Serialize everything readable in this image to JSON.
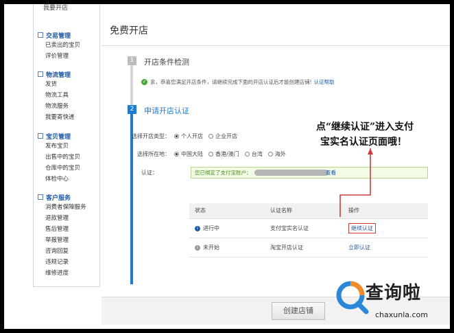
{
  "sidebar": {
    "top_item": "我要开店",
    "sections": [
      {
        "title": "交易管理",
        "items": [
          "已卖出的宝贝",
          "评价管理"
        ]
      },
      {
        "title": "物流管理",
        "items": [
          "发货",
          "物流工具",
          "物流服务",
          "我要寄快递"
        ]
      },
      {
        "title": "宝贝管理",
        "items": [
          "发布宝贝",
          "出售中的宝贝",
          "仓库中的宝贝",
          "体检中心"
        ]
      },
      {
        "title": "客户服务",
        "items": [
          "消费者保障服务",
          "退款管理",
          "售后管理",
          "举报管理",
          "咨询回复",
          "违规记录",
          "维修进度"
        ]
      }
    ]
  },
  "main": {
    "title": "免费开店",
    "step1": {
      "num": "1",
      "title": "开店条件检测"
    },
    "notice": {
      "icon": "✓",
      "text": "亲，恭喜您满足开店条件，请继续完成下面的开店认证后才能创建店铺!",
      "link": "认证帮助"
    },
    "step2": {
      "num": "2",
      "title": "申请开店认证"
    },
    "form": {
      "type_label": "选择开店类型：",
      "type_options": [
        "个人开店",
        "企业开店"
      ],
      "region_label": "选择所在地：",
      "region_options": [
        "中国大陆",
        "香港/澳门",
        "台湾",
        "海外"
      ],
      "auth_label": "认证：",
      "auth_text": "您已绑定了支付宝账户：",
      "auth_view": "查看"
    },
    "table": {
      "headers": [
        "状态",
        "认证名称",
        "操作"
      ],
      "rows": [
        {
          "icon": "i",
          "status": "进行中",
          "name": "支付宝实名认证",
          "action": "继续认证"
        },
        {
          "icon": "i",
          "status": "未开始",
          "name": "淘宝开店认证",
          "action": "立即认证"
        }
      ]
    },
    "create_button": "创建店铺"
  },
  "annotation": {
    "line1": "点“继续认证”进入支付",
    "line2": "宝实名认证页面哦！"
  },
  "watermark": {
    "text": "查询啦",
    "url": "chaxunla.com"
  },
  "colors": {
    "accent_blue": "#1f7bd0",
    "annotation_red": "#d23a3a",
    "success_green": "#4aa63b"
  }
}
